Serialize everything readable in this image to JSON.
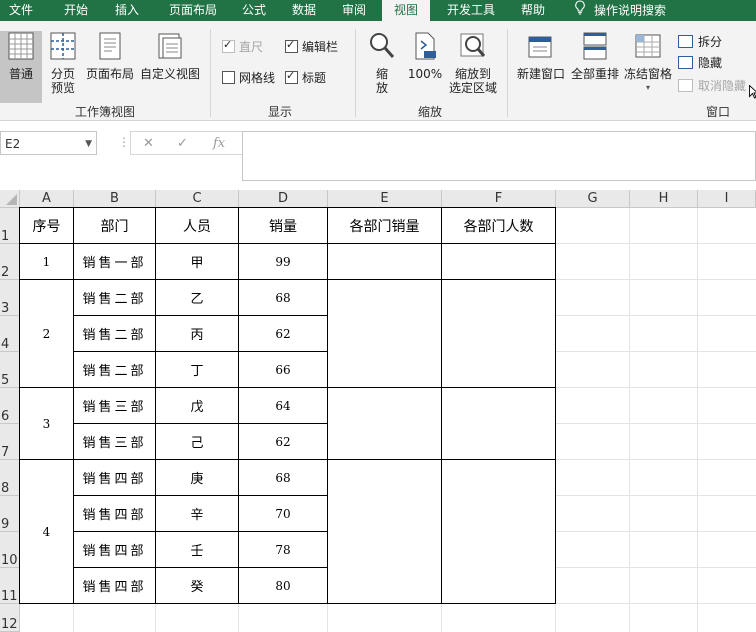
{
  "menu": {
    "tabs": [
      "文件",
      "开始",
      "插入",
      "页面布局",
      "公式",
      "数据",
      "审阅",
      "视图",
      "开发工具",
      "帮助"
    ],
    "active_tab": "视图",
    "tell_me": "操作说明搜索"
  },
  "ribbon": {
    "workbook_views": {
      "normal": "普通",
      "page_break_line1": "分页",
      "page_break_line2": "预览",
      "page_layout": "页面布局",
      "custom_views": "自定义视图",
      "group_label": "工作簿视图"
    },
    "show": {
      "ruler": "直尺",
      "formula_bar": "编辑栏",
      "gridlines": "网格线",
      "headings": "标题",
      "ruler_checked": true,
      "formula_bar_checked": true,
      "gridlines_checked": false,
      "headings_checked": true,
      "group_label": "显示"
    },
    "zoom": {
      "zoom_line1": "缩",
      "zoom_line2": "放",
      "hundred": "100%",
      "selection_line1": "缩放到",
      "selection_line2": "选定区域",
      "group_label": "缩放"
    },
    "window": {
      "new_window": "新建窗口",
      "arrange_all": "全部重排",
      "freeze_panes": "冻结窗格",
      "split": "拆分",
      "hide": "隐藏",
      "unhide": "取消隐藏",
      "group_label": "窗口"
    }
  },
  "formula_bar": {
    "name_box": "E2",
    "formula": ""
  },
  "sheet": {
    "columns": [
      "A",
      "B",
      "C",
      "D",
      "E",
      "F",
      "G",
      "H",
      "I"
    ],
    "rows": [
      "1",
      "2",
      "3",
      "4",
      "5",
      "6",
      "7",
      "8",
      "9",
      "10",
      "11",
      "12"
    ],
    "headers": [
      "序号",
      "部门",
      "人员",
      "销量",
      "各部门销量",
      "各部门人数"
    ],
    "seq": [
      "1",
      "2",
      "3",
      "4"
    ],
    "data": [
      {
        "dept": "销售一部",
        "person": "甲",
        "sales": "99"
      },
      {
        "dept": "销售二部",
        "person": "乙",
        "sales": "68"
      },
      {
        "dept": "销售二部",
        "person": "丙",
        "sales": "62"
      },
      {
        "dept": "销售二部",
        "person": "丁",
        "sales": "66"
      },
      {
        "dept": "销售三部",
        "person": "戊",
        "sales": "64"
      },
      {
        "dept": "销售三部",
        "person": "己",
        "sales": "62"
      },
      {
        "dept": "销售四部",
        "person": "庚",
        "sales": "68"
      },
      {
        "dept": "销售四部",
        "person": "辛",
        "sales": "70"
      },
      {
        "dept": "销售四部",
        "person": "壬",
        "sales": "78"
      },
      {
        "dept": "销售四部",
        "person": "癸",
        "sales": "80"
      }
    ]
  },
  "colors": {
    "accent": "#217346",
    "ribbon_bg": "#f3f3f3",
    "header_bg": "#e9e9e9"
  }
}
